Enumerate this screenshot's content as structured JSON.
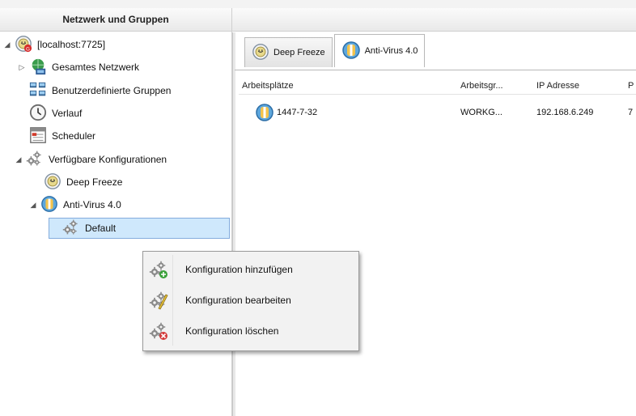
{
  "left_panel": {
    "title": "Netzwerk und Gruppen",
    "tree": [
      {
        "label": "[localhost:7725]",
        "icon": "server-icon",
        "toggle": "◢"
      },
      {
        "label": "Gesamtes Netzwerk",
        "icon": "network-globe-icon",
        "toggle": "▷"
      },
      {
        "label": "Benutzerdefinierte Gruppen",
        "icon": "user-groups-icon",
        "toggle": ""
      },
      {
        "label": "Verlauf",
        "icon": "clock-icon",
        "toggle": ""
      },
      {
        "label": "Scheduler",
        "icon": "scheduler-icon",
        "toggle": ""
      },
      {
        "label": "Verfügbare Konfigurationen",
        "icon": "gears-icon",
        "toggle": "◢"
      },
      {
        "label": "Deep Freeze",
        "icon": "deep-freeze-icon",
        "toggle": ""
      },
      {
        "label": "Anti-Virus 4.0",
        "icon": "antivirus-icon",
        "toggle": "◢"
      },
      {
        "label": "Default",
        "icon": "gears-icon",
        "toggle": ""
      }
    ]
  },
  "tabs": [
    {
      "label": "Deep Freeze",
      "icon": "deep-freeze-icon",
      "active": false
    },
    {
      "label": "Anti-Virus 4.0",
      "icon": "antivirus-icon",
      "active": true
    }
  ],
  "table": {
    "columns": [
      "Arbeitsplätze",
      "Arbeitsgr...",
      "IP Adresse",
      "P"
    ],
    "rows": [
      {
        "workstation": "1447-7-32",
        "group": "WORKG...",
        "ip": "192.168.6.249",
        "extra": "7"
      }
    ]
  },
  "context_menu": {
    "items": [
      {
        "label": "Konfiguration hinzufügen",
        "icon": "gears-add-icon"
      },
      {
        "label": "Konfiguration bearbeiten",
        "icon": "gears-edit-icon"
      },
      {
        "label": "Konfiguration löschen",
        "icon": "gears-delete-icon"
      }
    ]
  },
  "colors": {
    "selection_bg": "#cfe8fc",
    "selection_border": "#84acdd",
    "menu_bg": "#f2f2f2"
  }
}
